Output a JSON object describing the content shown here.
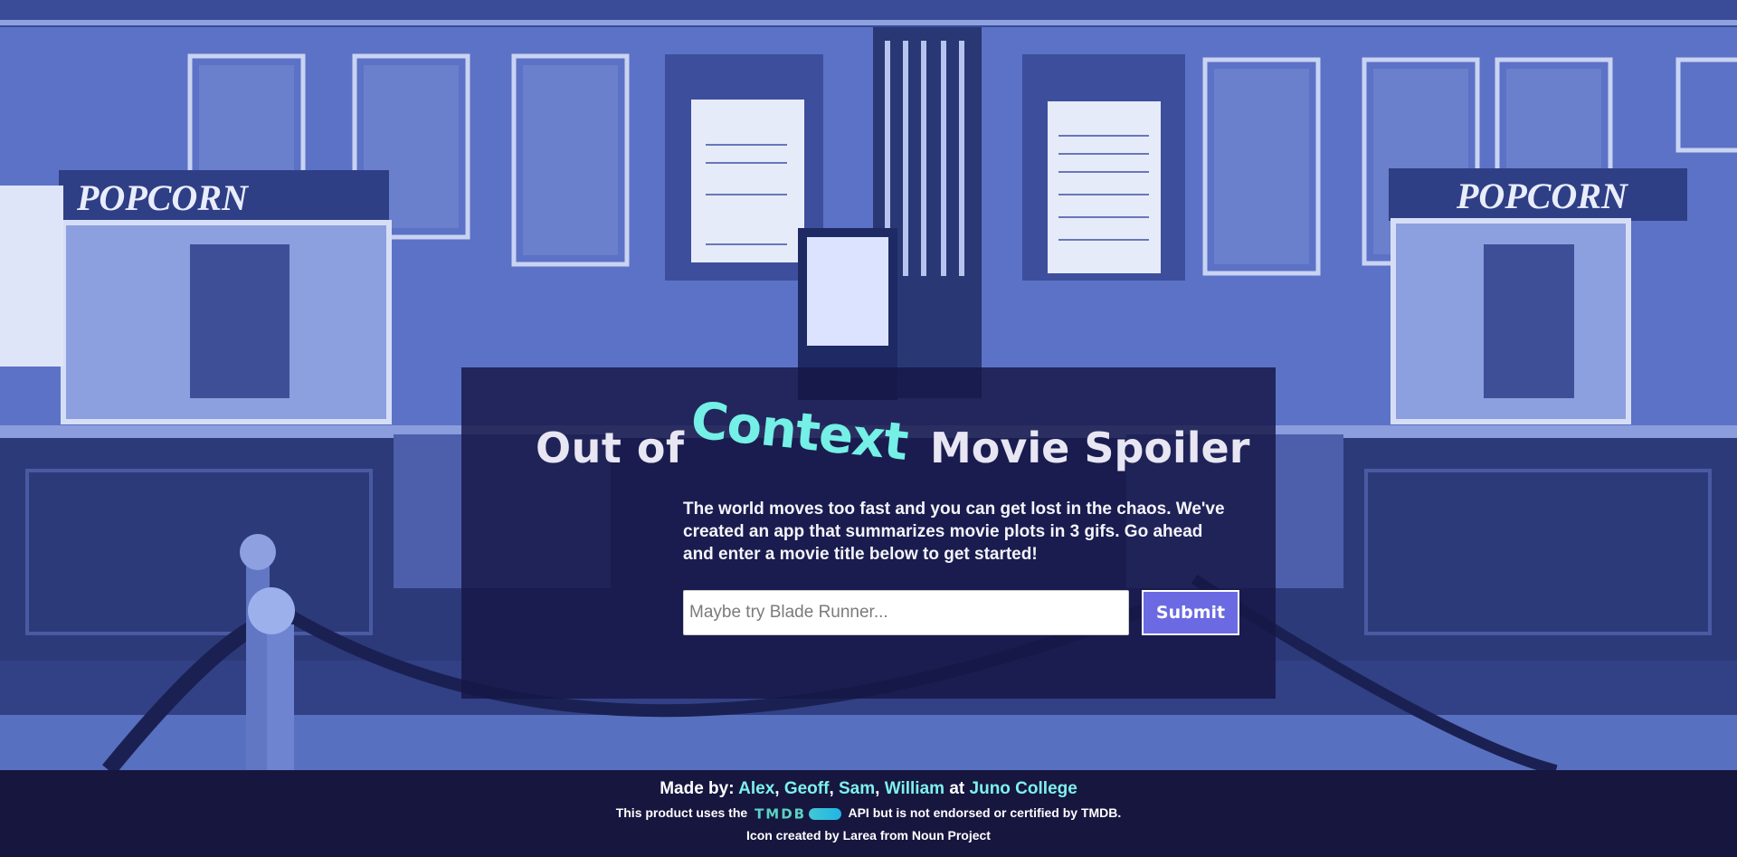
{
  "title": {
    "part1": "Out of",
    "highlight": "Context",
    "part2": "Movie Spoiler"
  },
  "intro": "The world moves too fast and you can get lost in the chaos. We've created an app that summarizes movie plots in 3 gifs. Go ahead and enter a movie title below to get started!",
  "search": {
    "placeholder": "Maybe try Blade Runner...",
    "value": ""
  },
  "submit_label": "Submit",
  "background": {
    "popcorn_sign_left": "POPCORN",
    "popcorn_sign_right": "POPCORN"
  },
  "footer": {
    "made_by_prefix": "Made by:",
    "authors": [
      "Alex",
      "Geoff",
      "Sam",
      "William"
    ],
    "separator": ",",
    "at": "at",
    "college": "Juno College",
    "tmdb_prefix": "This product uses the",
    "tmdb_word": "TMDB",
    "tmdb_suffix": "API but is not endorsed or certified by TMDB.",
    "icon_credit": "Icon created by Larea from Noun Project"
  },
  "colors": {
    "panel": "#161646",
    "accent": "#74f0e6",
    "submit": "#6b6ae3",
    "footer": "#16163f",
    "link": "#7ef1ea"
  }
}
